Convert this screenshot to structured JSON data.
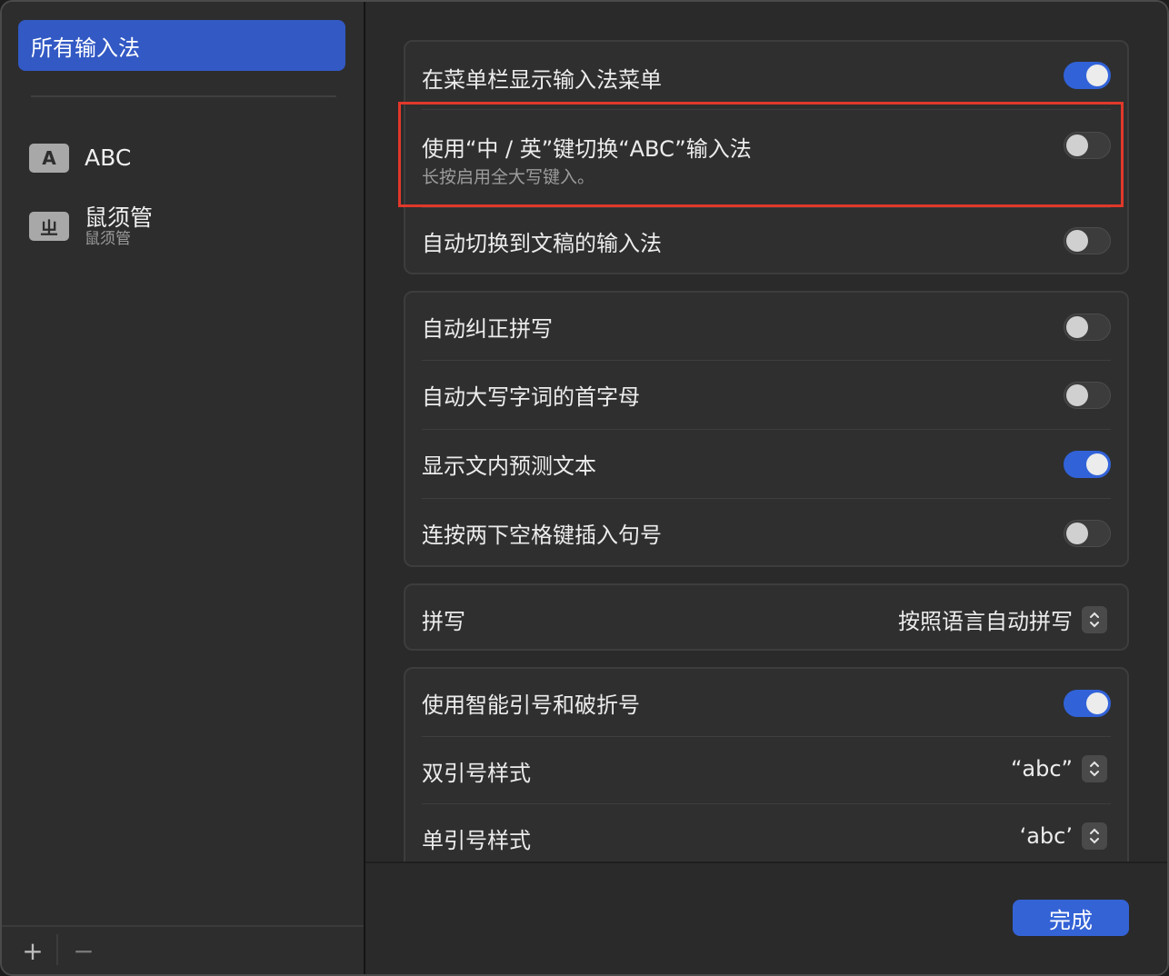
{
  "sidebar": {
    "selected_label": "所有输入法",
    "items": [
      {
        "badge": "A",
        "label": "ABC",
        "sub": ""
      },
      {
        "badge": "ㄓ",
        "label": "鼠须管",
        "sub": "鼠须管"
      }
    ],
    "add_label": "+",
    "remove_label": "−"
  },
  "group1": {
    "rows": [
      {
        "label": "在菜单栏显示输入法菜单",
        "toggle": true
      },
      {
        "label": "使用“中 / 英”键切换“ABC”输入法",
        "sub": "长按启用全大写键入。",
        "toggle": false
      },
      {
        "label": "自动切换到文稿的输入法",
        "toggle": false
      }
    ]
  },
  "group2": {
    "rows": [
      {
        "label": "自动纠正拼写",
        "toggle": false
      },
      {
        "label": "自动大写字词的首字母",
        "toggle": false
      },
      {
        "label": "显示文内预测文本",
        "toggle": true
      },
      {
        "label": "连按两下空格键插入句号",
        "toggle": false
      }
    ]
  },
  "group3": {
    "label": "拼写",
    "value": "按照语言自动拼写"
  },
  "group4": {
    "rows": [
      {
        "label": "使用智能引号和破折号",
        "toggle": true
      },
      {
        "label": "双引号样式",
        "value": "“abc”"
      },
      {
        "label": "单引号样式",
        "value": "‘abc’"
      }
    ]
  },
  "footer": {
    "done_label": "完成"
  },
  "colors": {
    "accent": "#3463d6",
    "highlight": "#e0382a"
  }
}
